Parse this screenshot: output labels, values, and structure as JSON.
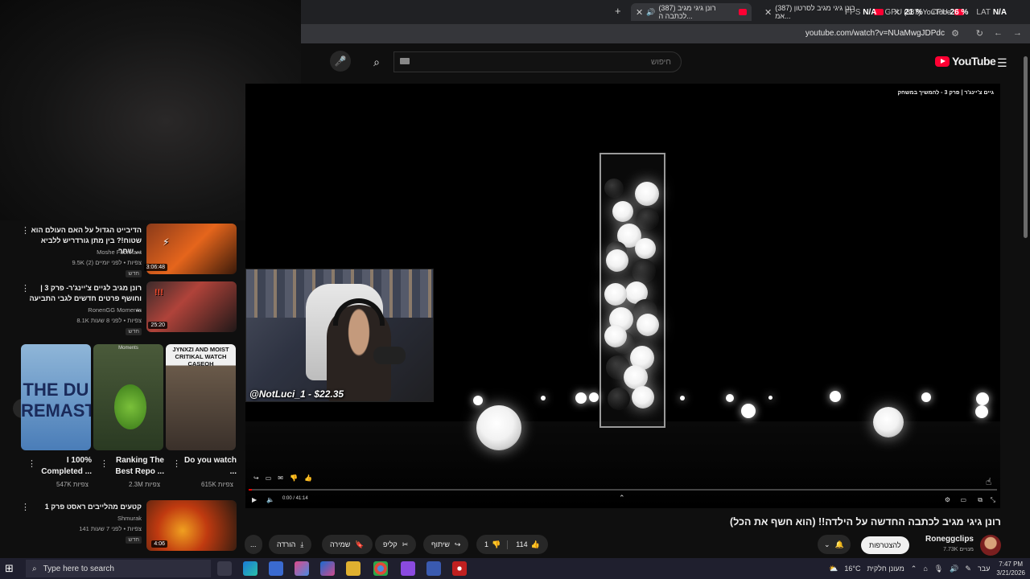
{
  "browser": {
    "tabs": [
      {
        "label": "(387) רונן גיגי מגיב לכתבה ה...",
        "active": true
      },
      {
        "label": "(387) רונן גיגי מגיב לסרטון אמ...",
        "active": false
      },
      {
        "label": "(387) YouTube",
        "active": false
      }
    ],
    "new_tab": "+",
    "url": "youtube.com/watch?v=NUaMwgJDPdc"
  },
  "perf_overlay": {
    "fps_label": "FPS",
    "fps": "N/A",
    "gpu_label": "GPU",
    "gpu": "21 %",
    "cpu_label": "CPU",
    "cpu": "26 %",
    "lat_label": "LAT",
    "lat": "N/A"
  },
  "youtube": {
    "logo": "YouTube",
    "search_placeholder": "חיפוש",
    "colors": {
      "brand": "#ff0033",
      "accent": "#3ea6ff"
    }
  },
  "player": {
    "overlay_title": "גיים צ'יינג'ר | פרק 3 - להמשיך במשחק",
    "time": "0:00 / 41:14",
    "progress": 0.0
  },
  "streamer": {
    "donation": "@NotLuci_1 - $22.35"
  },
  "video": {
    "title": "רונן גיגי מגיב לכתבה החדשה על הילדה!! (הוא חשף את הכל)",
    "channel": "Roneggclips",
    "subscribers": "7.73K מנויים",
    "subscribe_label": "להצטרפות",
    "likes": "114",
    "dislikes": "1",
    "share_label": "שיתוף",
    "clip_label": "קליפ",
    "save_label": "שמירה",
    "download_label": "הורדה",
    "more_label": "..."
  },
  "sidebar": {
    "videos": [
      {
        "title": "הדיבייט הגדול על האם העולם הוא שטוח!? בין מתן גורדריש ללביא שחר ...",
        "channel": "Moshe Fabrikant",
        "meta": "9.5K צפיות • לפני יומיים (2)",
        "badge": "חדש",
        "duration": "3:06:48"
      },
      {
        "title": "רונן מגיב לגיים צ'יינג'ר- פרק 3 | וחושף פרטים חדשים לגבי התביעה ...",
        "channel": "RonenGG Moments",
        "meta": "8.1K צפיות • לפני 8 שעות",
        "badge": "חדש",
        "duration": "25:20"
      },
      {
        "title": "קטעים מהלייבים ראסט פרק 1",
        "channel": "Shmurak",
        "meta": "141 צפיות • לפני 7 שעות",
        "badge": "חדש",
        "duration": "4:06"
      }
    ],
    "shorts": [
      {
        "title": "I 100% Completed ...",
        "views": "547K צפיות",
        "thumb_text": "THE DU REMASTERED"
      },
      {
        "title": "Ranking The Best Repo ...",
        "views": "2.3M צפיות",
        "thumb_text": "Moments"
      },
      {
        "title": "Do you watch ...",
        "views": "615K צפיות",
        "thumb_text": "JYNXZI AND MOIST CRITIKAL WATCH CASEOH"
      }
    ]
  },
  "taskbar": {
    "search_placeholder": "Type here to search",
    "weather": "16°C",
    "weather_desc": "מעונן חלקית",
    "lang": "עבר",
    "time": "7:47 PM",
    "date": "3/21/2026"
  }
}
